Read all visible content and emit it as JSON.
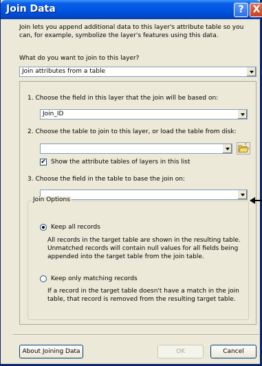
{
  "window": {
    "title": "Join Data"
  },
  "description": "Join lets you append additional data to this layer's attribute table so you can, for example, symbolize the layer's features using this data.",
  "question": "What do you want to join to this layer?",
  "join_type": {
    "value": "Join attributes from a table"
  },
  "step1": {
    "label": "1.  Choose the field in this layer that the join will be based on:",
    "value": "Join_ID"
  },
  "step2": {
    "label": "2.  Choose the table to join to this layer, or load the table from disk:",
    "value": ""
  },
  "show_attribute_tables": {
    "label": "Show the attribute tables of layers in this list",
    "checked": true,
    "mark": "✔"
  },
  "step3": {
    "label": "3.  Choose the field in the table to base the join on:",
    "value": ""
  },
  "join_options": {
    "legend": "Join Options",
    "keep_all": {
      "label": "Keep all records",
      "description": "All records in the target table are shown in the resulting table. Unmatched records will contain null values for all fields being appended into the target table from the join table.",
      "selected": true
    },
    "keep_matching": {
      "label": "Keep only matching records",
      "description": "If a record in the target table doesn't have a match in the join table, that record is removed from the resulting target table.",
      "selected": false
    }
  },
  "buttons": {
    "about": "About Joining Data",
    "ok": "OK",
    "cancel": "Cancel"
  },
  "titlebar_buttons": {
    "help": "?",
    "close": "X"
  },
  "icons": {
    "folder": "folder-open-icon",
    "arrow": "annotation-arrow-icon"
  },
  "colors": {
    "titlebar": "#0054e3",
    "dialog_bg": "#ece9d8",
    "field_border": "#7f9db9"
  }
}
